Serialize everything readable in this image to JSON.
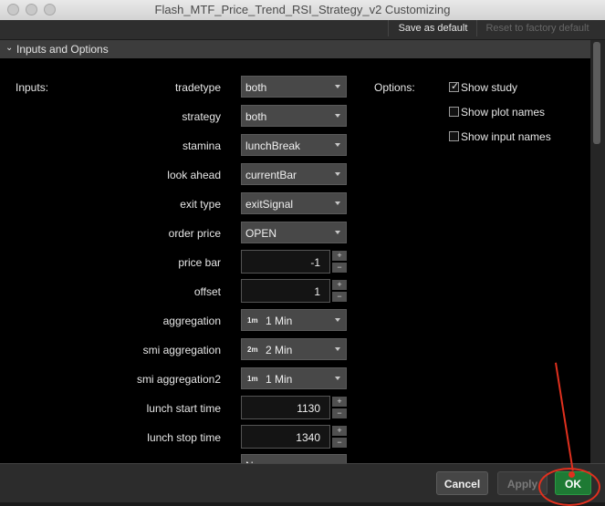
{
  "window": {
    "title": "Flash_MTF_Price_Trend_RSI_Strategy_v2 Customizing"
  },
  "toolbar": {
    "save_default": "Save as default",
    "reset_default": "Reset to factory default"
  },
  "section": {
    "title": "Inputs and Options"
  },
  "labels": {
    "inputs": "Inputs:",
    "options": "Options:"
  },
  "inputs": [
    {
      "label": "tradetype",
      "kind": "dropdown",
      "value": "both"
    },
    {
      "label": "strategy",
      "kind": "dropdown",
      "value": "both"
    },
    {
      "label": "stamina",
      "kind": "dropdown",
      "value": "lunchBreak"
    },
    {
      "label": "look ahead",
      "kind": "dropdown",
      "value": "currentBar"
    },
    {
      "label": "exit type",
      "kind": "dropdown",
      "value": "exitSignal"
    },
    {
      "label": "order price",
      "kind": "dropdown",
      "value": "OPEN"
    },
    {
      "label": "price bar",
      "kind": "number",
      "value": "-1"
    },
    {
      "label": "offset",
      "kind": "number",
      "value": "1"
    },
    {
      "label": "aggregation",
      "kind": "agg",
      "badge": "1m",
      "value": "1 Min"
    },
    {
      "label": "smi aggregation",
      "kind": "agg",
      "badge": "2m",
      "value": "2 Min"
    },
    {
      "label": "smi aggregation2",
      "kind": "agg",
      "badge": "1m",
      "value": "1 Min"
    },
    {
      "label": "lunch start time",
      "kind": "number",
      "value": "1130"
    },
    {
      "label": "lunch stop time",
      "kind": "number",
      "value": "1340"
    }
  ],
  "partial_dropdown": {
    "value": "N"
  },
  "options": [
    {
      "label": "Show study",
      "checked": true
    },
    {
      "label": "Show plot names",
      "checked": false
    },
    {
      "label": "Show input names",
      "checked": false
    }
  ],
  "buttons": {
    "cancel": "Cancel",
    "apply": "Apply",
    "ok": "OK"
  },
  "colors": {
    "ok_bg": "#1e7a34",
    "annotation": "#e0301e",
    "content_bg": "#000000"
  }
}
